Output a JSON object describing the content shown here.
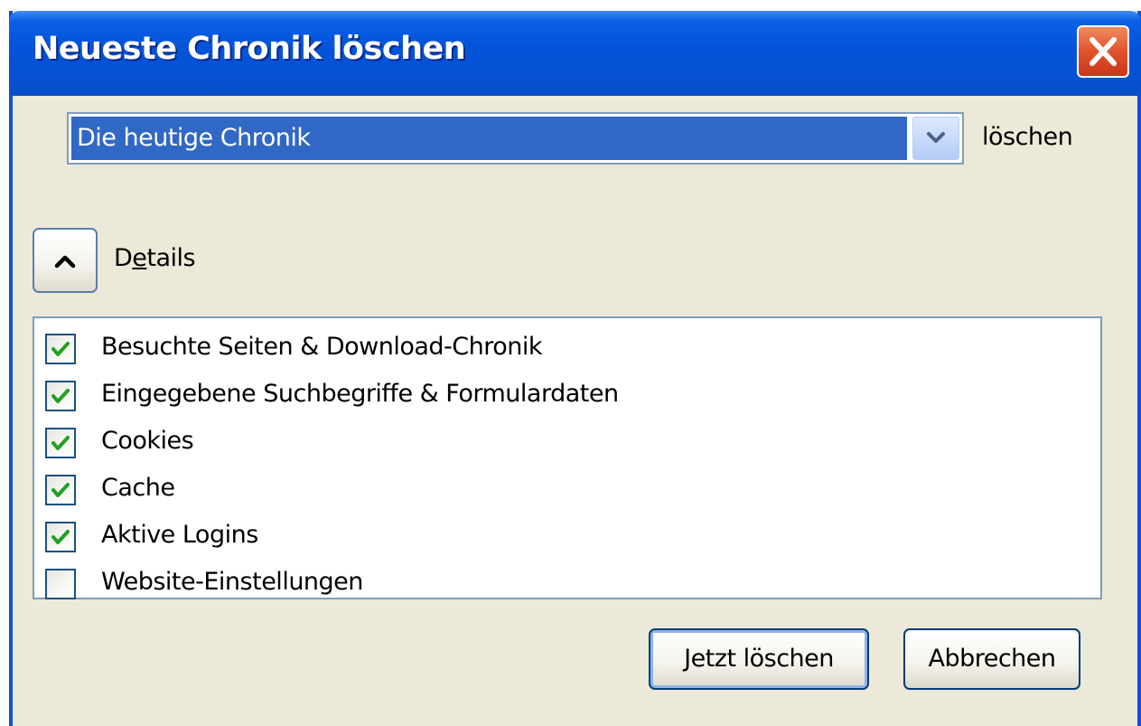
{
  "dialog": {
    "title": "Neueste Chronik löschen",
    "close_icon": "close-icon"
  },
  "time_range": {
    "selected": "Die heutige Chronik",
    "suffix_label": "löschen"
  },
  "details": {
    "label_before": "D",
    "label_mnemonic": "e",
    "label_after": "tails",
    "toggle_icon": "chevron-up-icon",
    "expanded": true
  },
  "items": [
    {
      "label": "Besuchte Seiten & Download-Chronik",
      "checked": true
    },
    {
      "label": "Eingegebene Suchbegriffe & Formulardaten",
      "checked": true
    },
    {
      "label": "Cookies",
      "checked": true
    },
    {
      "label": "Cache",
      "checked": true
    },
    {
      "label": "Aktive Logins",
      "checked": true
    },
    {
      "label": "Website-Einstellungen",
      "checked": false
    }
  ],
  "buttons": {
    "clear_now": "Jetzt löschen",
    "cancel": "Abbrechen"
  },
  "colors": {
    "titlebar": "#0453d8",
    "dialog_bg": "#ece9d8",
    "selection": "#3168c5",
    "check": "#21a121",
    "close_button": "#e0532b"
  }
}
